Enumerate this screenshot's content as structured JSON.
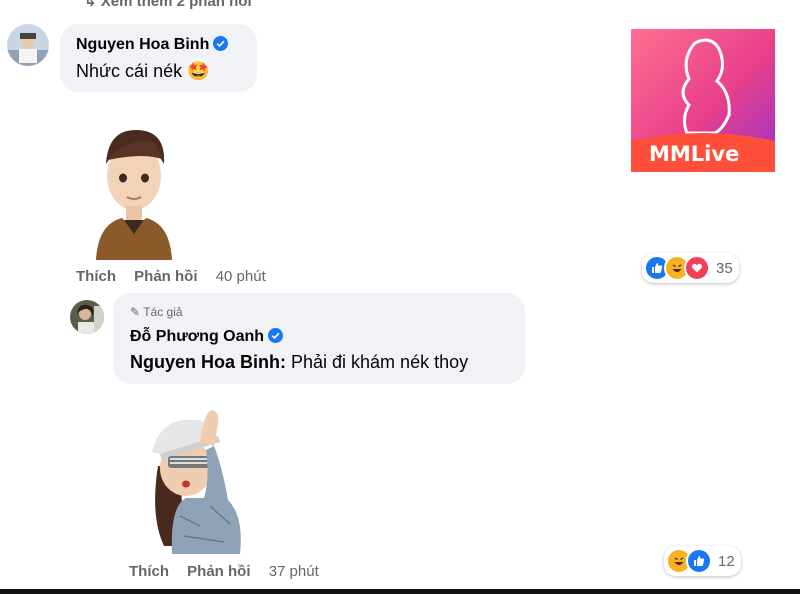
{
  "top_row": {
    "label": "Xem thêm 2 phản hồi"
  },
  "comment1": {
    "author": "Nguyen Hoa Binh",
    "text": "Nhức cái nék",
    "emoji": "🤩",
    "actions": {
      "like": "Thích",
      "reply": "Phản hồi",
      "time": "40 phút"
    },
    "reaction_count": "35"
  },
  "reply1": {
    "badge": "Tác giả",
    "author": "Đỗ Phương Oanh",
    "mention": "Nguyen Hoa Binh:",
    "text": " Phải đi khám nék thoy",
    "actions": {
      "like": "Thích",
      "reply": "Phản hồi",
      "time": "37 phút"
    },
    "reaction_count": "12"
  },
  "ad": {
    "logo_text": "MMLive"
  },
  "colors": {
    "like_blue": "#1877f2",
    "love_red": "#f33e58",
    "haha_yellow": "#f7b125",
    "bubble_bg": "#f0f2f5",
    "meta_gray": "#65676b"
  }
}
